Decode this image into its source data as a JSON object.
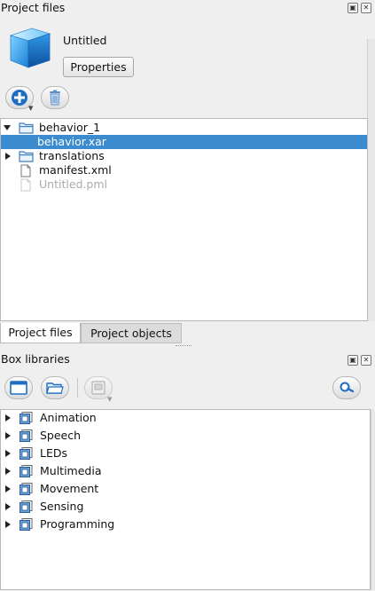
{
  "project_panel": {
    "title": "Project files",
    "project_name": "Untitled",
    "properties_label": "Properties"
  },
  "project_tree": {
    "items": [
      {
        "label": "behavior_1",
        "type": "folder",
        "expanded": true
      },
      {
        "label": "behavior.xar",
        "type": "file",
        "selected": true
      },
      {
        "label": "translations",
        "type": "folder",
        "expanded": false
      },
      {
        "label": "manifest.xml",
        "type": "file"
      },
      {
        "label": "Untitled.pml",
        "type": "file",
        "dimmed": true
      }
    ]
  },
  "tabs": [
    {
      "label": "Project files",
      "active": true
    },
    {
      "label": "Project objects",
      "active": false
    }
  ],
  "box_libraries": {
    "title": "Box libraries",
    "items": [
      {
        "label": "Animation"
      },
      {
        "label": "Speech"
      },
      {
        "label": "LEDs"
      },
      {
        "label": "Multimedia"
      },
      {
        "label": "Movement"
      },
      {
        "label": "Sensing"
      },
      {
        "label": "Programming"
      }
    ]
  },
  "icons": {
    "float": "float-icon",
    "close": "close-icon",
    "project": "cube-icon",
    "add": "add-icon",
    "delete": "trash-icon",
    "folder": "folder-icon",
    "file": "file-icon",
    "new_window": "window-icon",
    "open": "open-folder-icon",
    "import": "import-box-icon",
    "search": "search-icon",
    "library": "box-library-icon"
  },
  "colors": {
    "selection": "#3a8bd0",
    "accent": "#1e6fc4"
  }
}
